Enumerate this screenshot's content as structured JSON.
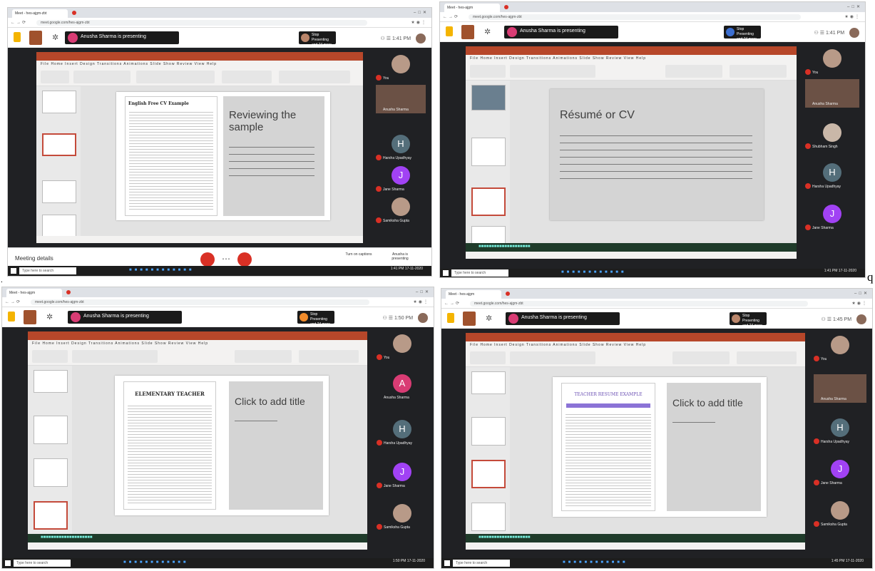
{
  "separators": {
    "dot": ".",
    "q": "q"
  },
  "shots": [
    {
      "tab_title": "Meet - hes-ajgm-zbt",
      "address": "meet.google.com/hes-ajgm-zbt",
      "presenter": "Anusha Sharma is presenting",
      "stop_label": "Stop Presenting and 24 more",
      "time": "1:41 PM",
      "slide_doc_title": "English Free CV Example",
      "slide_title": "Reviewing the sample",
      "participants": [
        "You",
        "Anusha Sharma",
        "Harsha Upadhyay",
        "Jane Sharma",
        "Samiksha Gupta"
      ],
      "meeting_details": "Meeting details",
      "right_controls": [
        "Turn on captions",
        "Anusha is presenting"
      ],
      "taskbar_search": "Type here to search",
      "clock": "1:41 PM 17-11-2020"
    },
    {
      "tab_title": "Meet - hes-ajgm",
      "address": "meet.google.com/hes-ajgm-zbt",
      "presenter": "Anusha Sharma is presenting",
      "stop_label": "Stop Presenting and 24 more",
      "time": "1:41 PM",
      "slide_title": "Résumé or CV",
      "participants": [
        "You",
        "Anusha Sharma",
        "Shubham Singh",
        "Harsha Upadhyay",
        "Jane Sharma"
      ],
      "taskbar_search": "Type here to search",
      "clock": "1:41 PM 17-11-2020"
    },
    {
      "tab_title": "Meet - hes-ajgm",
      "address": "meet.google.com/hes-ajgm-zbt",
      "presenter": "Anusha Sharma is presenting",
      "stop_label": "Stop Presenting and 24 more",
      "time": "1:50 PM",
      "slide_doc_title": "ELEMENTARY TEACHER",
      "slide_title": "Click to add title",
      "participants": [
        "You",
        "Anusha Sharma",
        "Harsha Upadhyay",
        "Jane Sharma",
        "Samiksha Gupta"
      ],
      "taskbar_search": "Type here to search",
      "clock": "1:50 PM 17-11-2020"
    },
    {
      "tab_title": "Meet - hes-ajgm",
      "address": "meet.google.com/hes-ajgm-zbt",
      "presenter": "Anusha Sharma is presenting",
      "stop_label": "Stop Presenting and 24 more",
      "time": "1:45 PM",
      "slide_doc_title": "TEACHER RESUME EXAMPLE",
      "slide_title": "Click to add title",
      "participants": [
        "You",
        "Anusha Sharma",
        "Harsha Upadhyay",
        "Jane Sharma",
        "Samiksha Gupta"
      ],
      "taskbar_search": "Type here to search",
      "clock": "1:45 PM 17-11-2020"
    }
  ],
  "colors": {
    "meet_red": "#d93025",
    "ppt_orange": "#b7472a",
    "avatar_blue": "#546e7a",
    "avatar_purple": "#a142f4",
    "avatar_pink": "#d93c74"
  },
  "icons": [
    "lock-icon",
    "gear-icon",
    "chat-icon",
    "people-icon",
    "mic-off-icon",
    "end-call-icon",
    "camera-off-icon",
    "windows-start-icon"
  ]
}
